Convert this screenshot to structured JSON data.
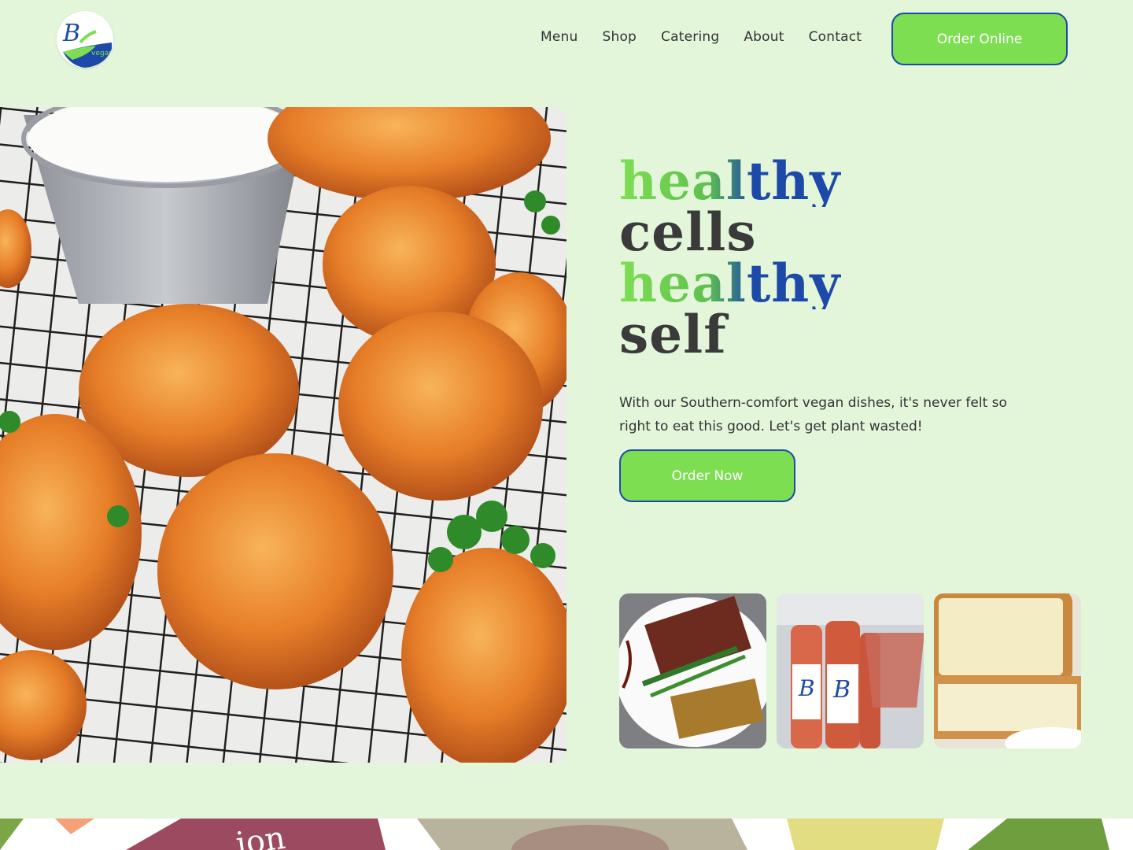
{
  "brand": {
    "logo_letters": "B",
    "logo_word": "vegan",
    "colors": {
      "green": "#7ede52",
      "blue": "#1d4aa8",
      "background": "#e3f6da"
    }
  },
  "nav": {
    "items": [
      "Menu",
      "Shop",
      "Catering",
      "About",
      "Contact"
    ],
    "cta": "Order Online"
  },
  "hero": {
    "headline": [
      "healthy",
      "cells",
      "healthy",
      "self"
    ],
    "tagline": "With our Southern-comfort vegan dishes, it's never felt so right to eat this good. Let's get plant wasted!",
    "cta": "Order Now",
    "image": "buffalo-cauliflower-photo"
  },
  "thumbnails": [
    {
      "name": "plated-meal-photo"
    },
    {
      "name": "juice-bottles-photo",
      "label": "B"
    },
    {
      "name": "lemon-cake-photo"
    }
  ],
  "bottom_strip": {
    "text": "ion"
  }
}
